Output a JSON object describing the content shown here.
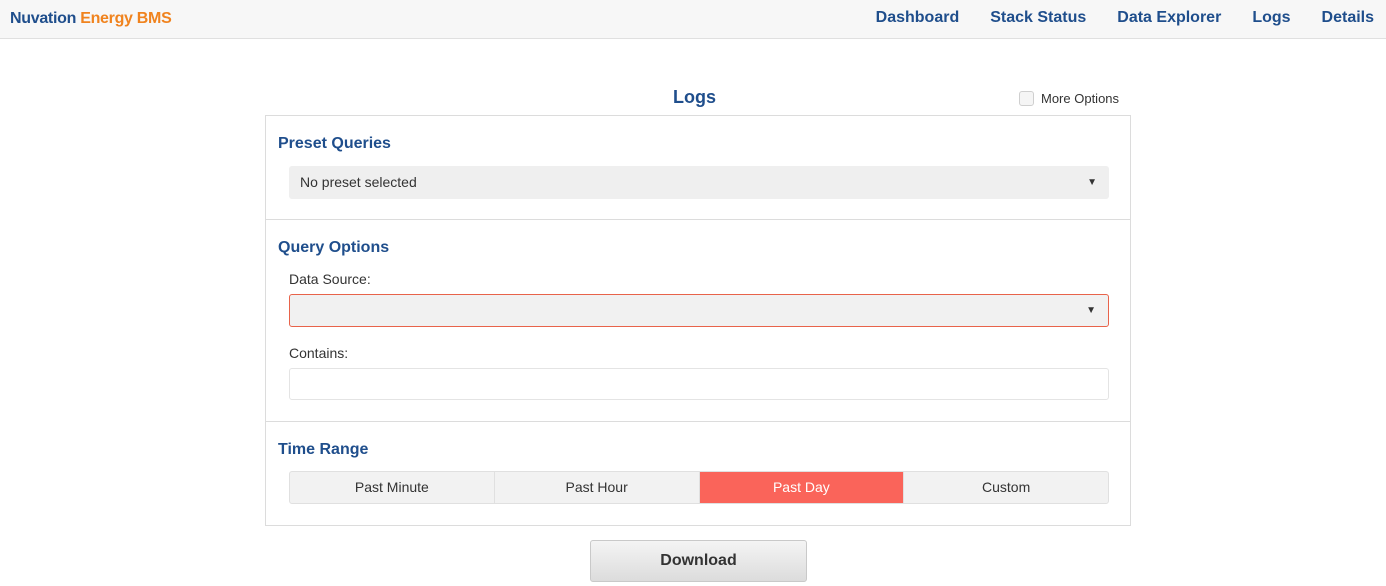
{
  "brand": {
    "part1": "Nuvation",
    "part2": "Energy BMS"
  },
  "nav": {
    "dashboard": "Dashboard",
    "stack_status": "Stack Status",
    "data_explorer": "Data Explorer",
    "logs": "Logs",
    "details": "Details"
  },
  "page": {
    "title": "Logs",
    "more_options_label": "More Options"
  },
  "preset": {
    "title": "Preset Queries",
    "selected": "No preset selected"
  },
  "query": {
    "title": "Query Options",
    "data_source_label": "Data Source:",
    "data_source_value": "",
    "contains_label": "Contains:",
    "contains_value": ""
  },
  "time_range": {
    "title": "Time Range",
    "options": [
      "Past Minute",
      "Past Hour",
      "Past Day",
      "Custom"
    ],
    "selected": "Past Day"
  },
  "actions": {
    "download": "Download"
  },
  "colors": {
    "brand_blue": "#1f4e8c",
    "brand_orange": "#f0831e",
    "accent_active": "#fa645a",
    "error_border": "#e8634a"
  }
}
